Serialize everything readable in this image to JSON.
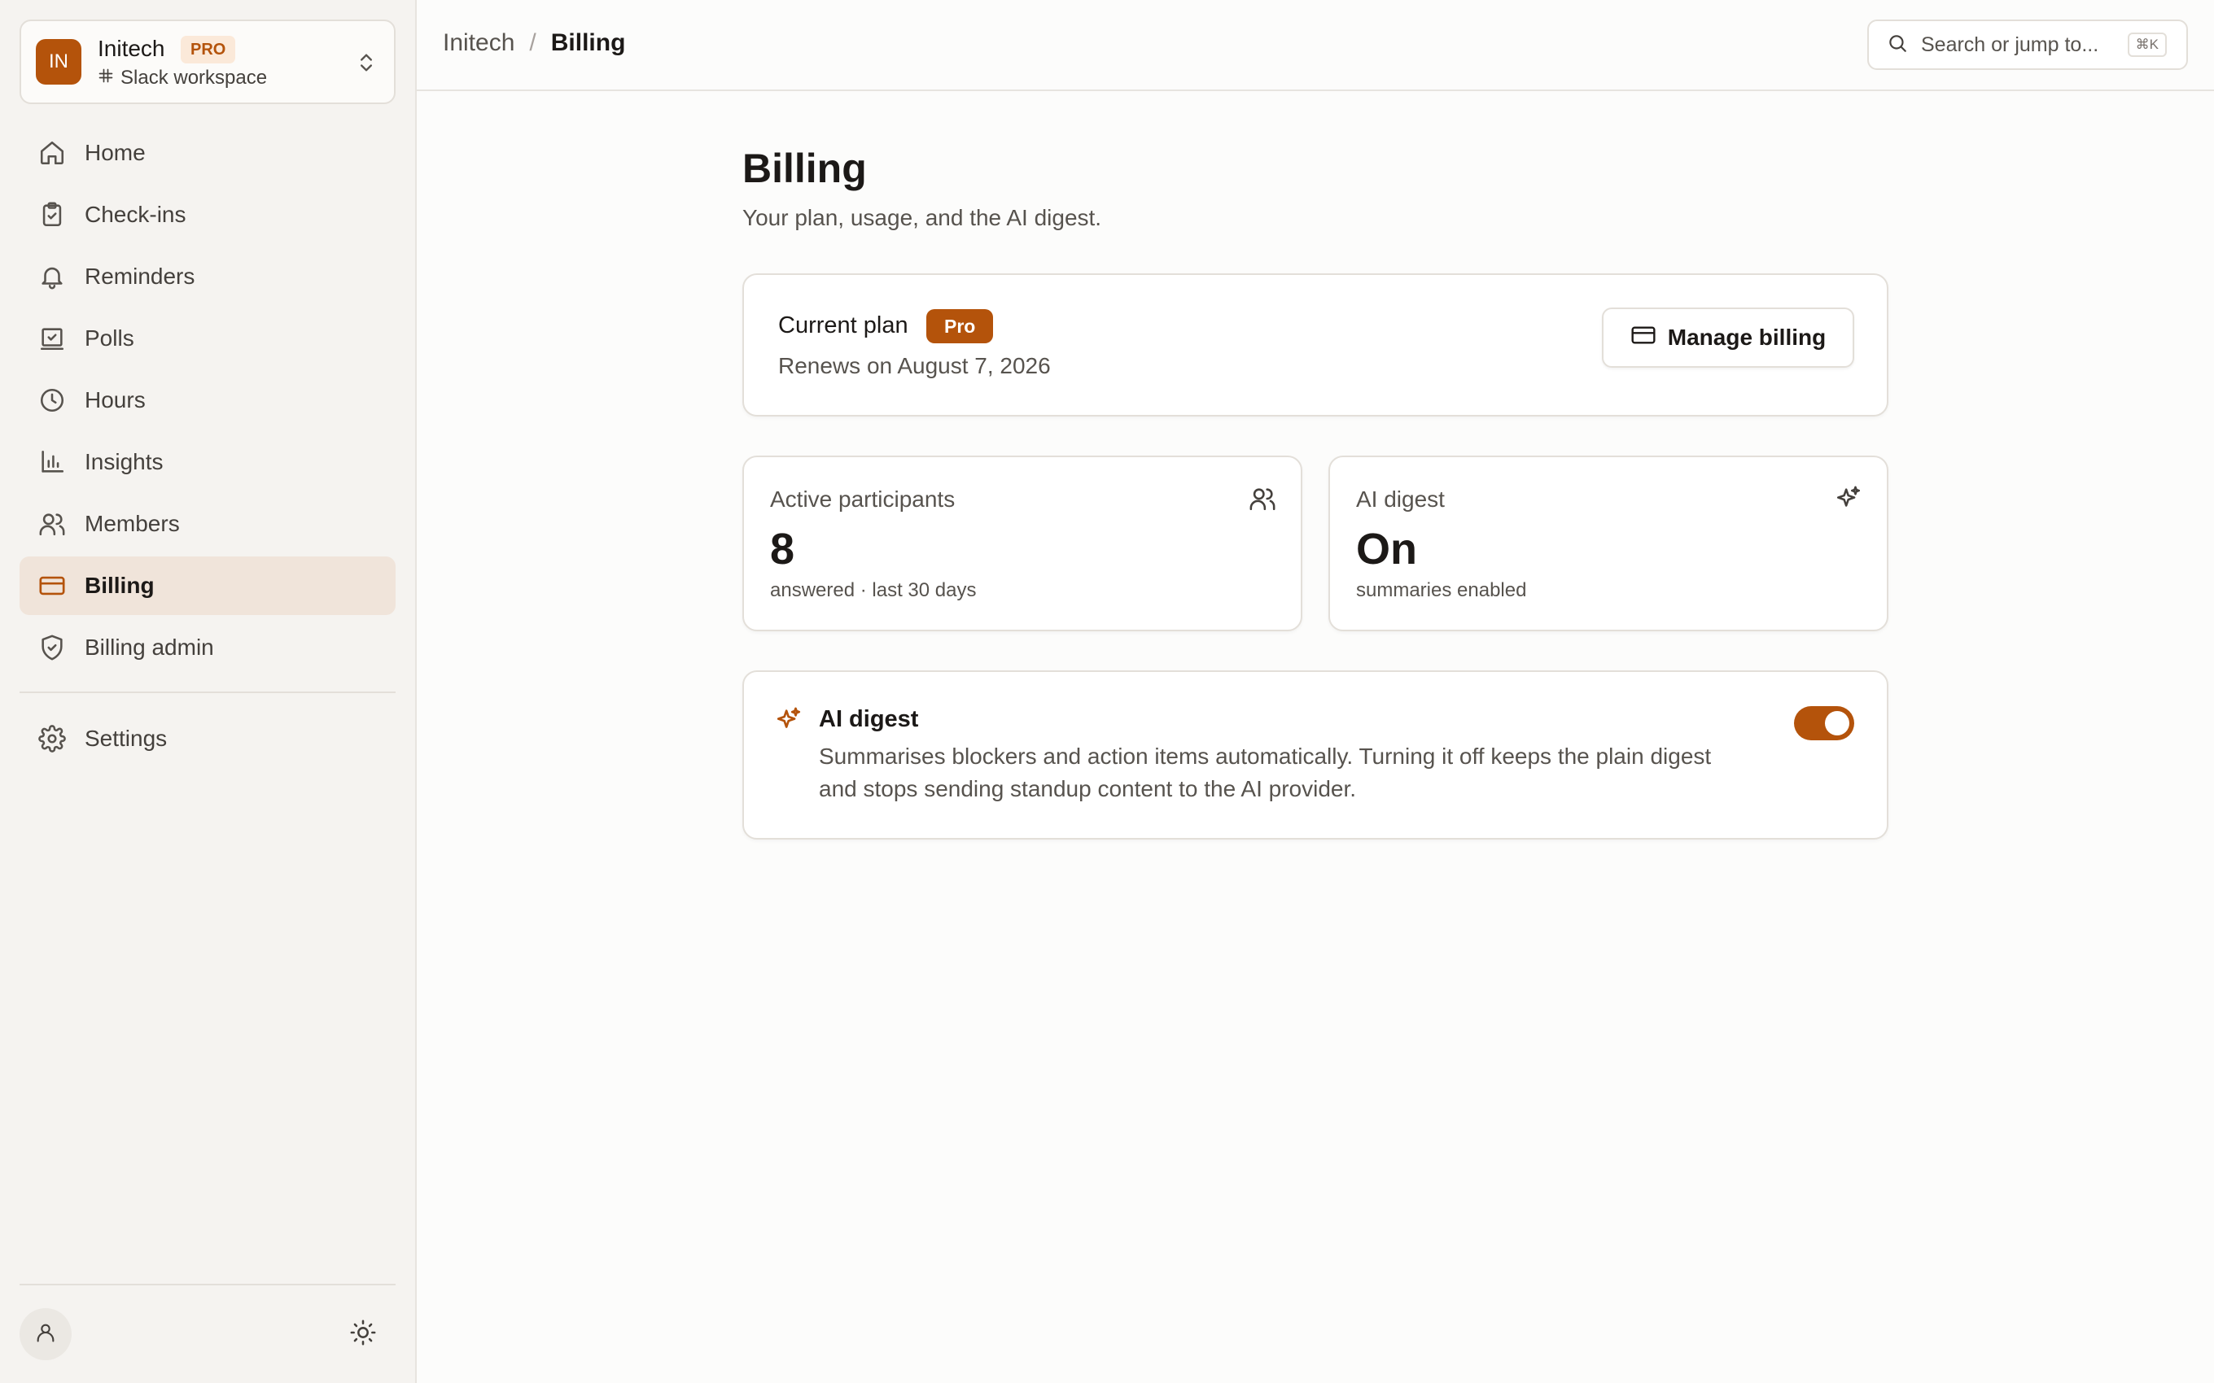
{
  "workspace": {
    "initials": "IN",
    "name": "Initech",
    "plan_badge": "PRO",
    "subtitle": "Slack workspace"
  },
  "nav": {
    "items": [
      {
        "label": "Home",
        "icon": "home-icon"
      },
      {
        "label": "Check-ins",
        "icon": "clipboard-check-icon"
      },
      {
        "label": "Reminders",
        "icon": "bell-icon"
      },
      {
        "label": "Polls",
        "icon": "poll-box-icon"
      },
      {
        "label": "Hours",
        "icon": "clock-icon"
      },
      {
        "label": "Insights",
        "icon": "bar-chart-icon"
      },
      {
        "label": "Members",
        "icon": "users-icon"
      },
      {
        "label": "Billing",
        "icon": "credit-card-icon",
        "active": true
      },
      {
        "label": "Billing admin",
        "icon": "shield-check-icon"
      }
    ],
    "settings_label": "Settings"
  },
  "topbar": {
    "breadcrumb": [
      "Initech",
      "Billing"
    ],
    "search_placeholder": "Search or jump to...",
    "search_shortcut": "⌘K"
  },
  "page": {
    "title": "Billing",
    "subtitle": "Your plan, usage, and the AI digest."
  },
  "plan": {
    "label": "Current plan",
    "badge": "Pro",
    "renews": "Renews on August 7, 2026",
    "manage_button": "Manage billing"
  },
  "stats": {
    "participants": {
      "label": "Active participants",
      "value": "8",
      "note": "answered · last 30 days"
    },
    "digest": {
      "label": "AI digest",
      "value": "On",
      "note": "summaries enabled"
    }
  },
  "ai_digest": {
    "title": "AI digest",
    "description": "Summarises blockers and action items automatically. Turning it off keeps the plain digest and stops sending standup content to the AI provider.",
    "enabled": true
  },
  "colors": {
    "accent": "#b4530b",
    "accent_soft": "#fbe9d9",
    "active_nav_bg": "#f0e4da",
    "sidebar_bg": "#f5f3f0",
    "page_bg": "#fcfcfb"
  }
}
